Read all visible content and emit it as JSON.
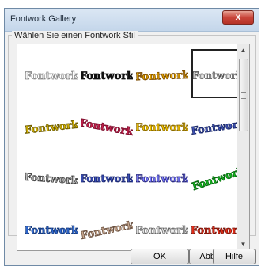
{
  "window": {
    "title": "Fontwork Gallery",
    "close_glyph": "x"
  },
  "group": {
    "label": "Wählen Sie einen Fontwork Stil"
  },
  "gallery": {
    "items": [
      {
        "text": "Fontwork",
        "fill": "#ffffff",
        "stroke": "#8a8a8a"
      },
      {
        "text": "Fontwork",
        "fill": "#111111",
        "stroke": "#111111"
      },
      {
        "text": "Fontwork",
        "fill": "#e0a100",
        "stroke": "#7a4a00"
      },
      {
        "text": "Fontwork",
        "fill": "#cfcfcf",
        "stroke": "#555555"
      },
      {
        "text": "Fontwork",
        "fill": "#d3b100",
        "stroke": "#6f5e00"
      },
      {
        "text": "Fontwork",
        "fill": "#c21f4a",
        "stroke": "#7d0f2e"
      },
      {
        "text": "Fontwork",
        "fill": "#f2c300",
        "stroke": "#8a6a00"
      },
      {
        "text": "Fontwork",
        "fill": "#3f51b5",
        "stroke": "#1b2a6b"
      },
      {
        "text": "Fontwork",
        "fill": "#bdbdbd",
        "stroke": "#444444"
      },
      {
        "text": "Fontwork",
        "fill": "#3a4fb8",
        "stroke": "#1b2770"
      },
      {
        "text": "Fontwork",
        "fill": "#7c7cff",
        "stroke": "#2a2a80"
      },
      {
        "text": "Fontwork",
        "fill": "#14b51f",
        "stroke": "#0a6a11"
      },
      {
        "text": "Fontwork",
        "fill": "#2f6bd6",
        "stroke": "#163a7d"
      },
      {
        "text": "Fontwork",
        "fill": "#c8a88f",
        "stroke": "#6b5140"
      },
      {
        "text": "Fontwork",
        "fill": "#e6e6e6",
        "stroke": "#6a6a6a"
      },
      {
        "text": "Fontwork",
        "fill": "#f12f1a",
        "stroke": "#7a160c"
      }
    ],
    "selected_index": 3
  },
  "buttons": {
    "ok": "OK",
    "cancel": "Abbrechen",
    "help": "Hilfe"
  }
}
